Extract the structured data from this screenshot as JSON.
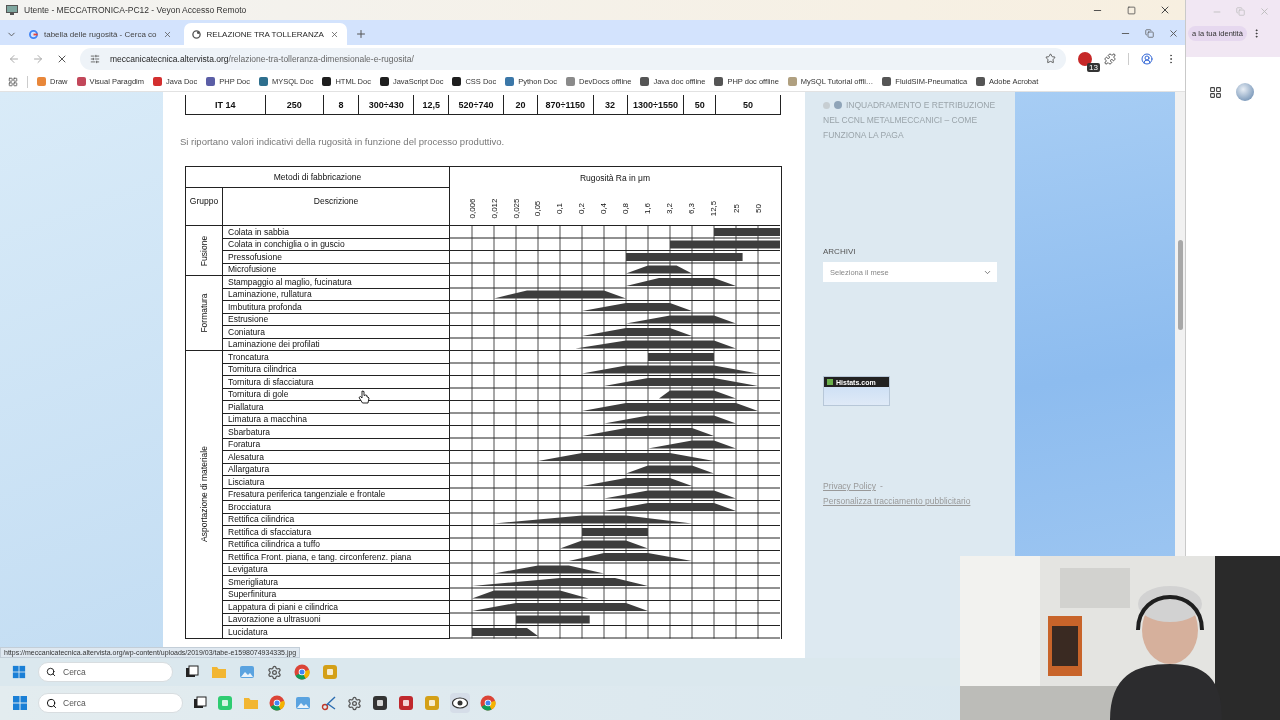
{
  "remote_window": {
    "title": "Utente - MECCATRONICA-PC12 - Veyon Accesso Remoto"
  },
  "browser": {
    "tabs": [
      {
        "title": "tabella delle rugosità - Cerca co",
        "selected": false
      },
      {
        "title": "RELAZIONE TRA TOLLERANZA",
        "selected": true
      }
    ],
    "url": {
      "domain": "meccanicatecnica.altervista.org",
      "path": "/relazione-tra-tolleranza-dimensionale-e-rugosita/"
    },
    "extension_badge": "13",
    "bookmarks": [
      {
        "label": "Draw",
        "color": "#e8873a"
      },
      {
        "label": "Visual Paragdim",
        "color": "#c2475a"
      },
      {
        "label": "Java Doc",
        "color": "#d32f2f"
      },
      {
        "label": "PHP Doc",
        "color": "#5b5ea6"
      },
      {
        "label": "MYSQL Doc",
        "color": "#2e6f8e"
      },
      {
        "label": "HTML Doc",
        "color": "#1e1e1e"
      },
      {
        "label": "JavaScript Doc",
        "color": "#1e1e1e"
      },
      {
        "label": "CSS Doc",
        "color": "#1e1e1e"
      },
      {
        "label": "Python Doc",
        "color": "#3b77a8"
      },
      {
        "label": "DevDocs offline",
        "color": "#8a8a8a"
      },
      {
        "label": "Java doc offline",
        "color": "#555555"
      },
      {
        "label": "PHP doc offline",
        "color": "#555555"
      },
      {
        "label": "MySQL Tutorial offli…",
        "color": "#b0a080"
      },
      {
        "label": "FluidSIM-Pneumatica",
        "color": "#555555"
      },
      {
        "label": "Adobe Acrobat",
        "color": "#555555"
      }
    ]
  },
  "page": {
    "tolerance_row": [
      "IT 14",
      "250",
      "8",
      "300÷430",
      "12,5",
      "520÷740",
      "20",
      "870÷1150",
      "32",
      "1300÷1550",
      "50",
      "50"
    ],
    "caption": "Si riportano valori indicativi della rugosità in funzione del processo produttivo.",
    "roughness_table": {
      "methods_header": "Metodi di fabbricazione",
      "group_header": "Gruppo",
      "description_header": "Descrizione",
      "scale_title": "Rugosità Ra in μm",
      "scale": [
        "0,006",
        "0,012",
        "0,025",
        "0,05",
        "0,1",
        "0,2",
        "0,4",
        "0,8",
        "1,6",
        "3,2",
        "6,3",
        "12,5",
        "25",
        "50"
      ],
      "groups": [
        {
          "name": "Fusione",
          "rows": [
            "Colata in sabbia",
            "Colata in conchiglia o in guscio",
            "Pressofusione",
            "Microfusione"
          ]
        },
        {
          "name": "Formatura",
          "rows": [
            "Stampaggio al maglio, fucinatura",
            "Laminazione, rullatura",
            "Imbutitura profonda",
            "Estrusione",
            "Coniatura",
            "Laminazione dei profilati"
          ]
        },
        {
          "name": "Asportazione di materiale",
          "rows": [
            "Troncatura",
            "Tornitura cilindrica",
            "Tornitura di sfacciatura",
            "Tornitura di gole",
            "Piallatura",
            "Limatura a macchina",
            "Sbarbatura",
            "Foratura",
            "Alesatura",
            "Allargatura",
            "Lisciatura",
            "Fresatura periferica tangenziale e frontale",
            "Brocciatura",
            "Rettifica cilindrica",
            "Rettifica di sfacciatura",
            "Rettifica cilindrica a tuffo",
            "Rettifica Front. piana, e tang. circonferenz. piana",
            "Levigatura",
            "Smerigliatura",
            "Superfinitura",
            "Lappatura di piani e cilindrica",
            "Lavorazione a ultrasuoni",
            "Lucidatura"
          ]
        }
      ]
    },
    "sidebar": {
      "recent_post": "INQUADRAMENTO E RETRIBUZIONE NEL CCNL METALMECCANICI – COME FUNZIONA LA PAGA",
      "archive_title": "ARCHIVI",
      "archive_select": "Seleziona il mese",
      "counter_title": "Histats.com",
      "footer_links": [
        "Privacy Policy",
        "Personalizza tracciamento pubblicitario"
      ],
      "footer_separator": "-"
    }
  },
  "status_url": "https://meccanicatecnica.altervista.org/wp-content/uploads/2019/03/tabe-e1598074934335.jpg",
  "remote_taskbar": {
    "search": {
      "placeholder": "Cerca"
    }
  },
  "side_window": {
    "identity_chip": "a la tua identità"
  },
  "taskbar": {
    "search": {
      "placeholder": "Cerca"
    }
  }
}
